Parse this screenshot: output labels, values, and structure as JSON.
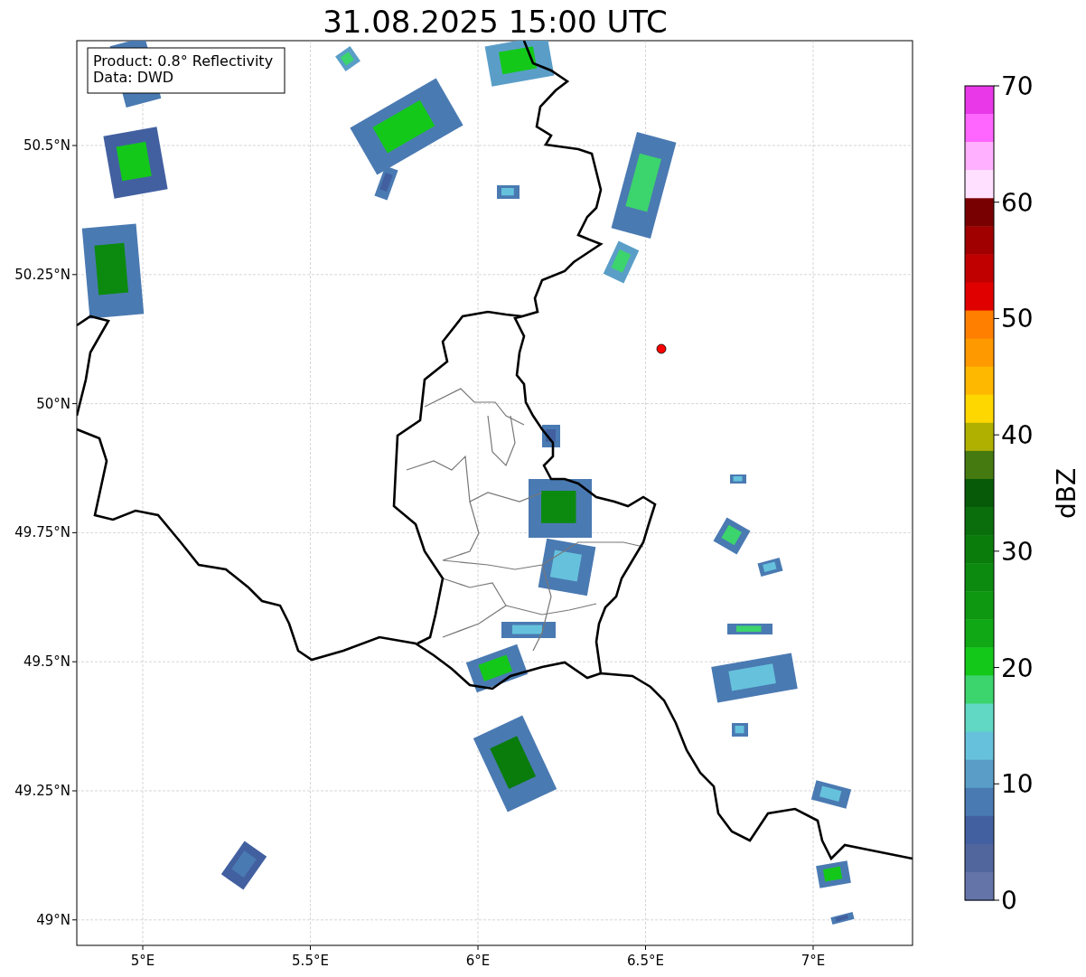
{
  "title": "31.08.2025 15:00 UTC",
  "info_box": {
    "lines": [
      "Product: 0.8° Reflectivity",
      "Data: DWD"
    ]
  },
  "map": {
    "y_labels": [
      "50.5°N",
      "50.25°N",
      "50°N",
      "49.75°N",
      "49.5°N",
      "49.25°N",
      "49°N"
    ],
    "x_labels": [
      "5°E",
      "5.5°E",
      "6°E",
      "6.5°E",
      "7°E"
    ]
  },
  "colorbar": {
    "label": "dBZ",
    "ticks": [
      "70",
      "60",
      "50",
      "40",
      "30",
      "20",
      "10",
      "0"
    ],
    "segments": [
      {
        "color": "#e838e8"
      },
      {
        "color": "#ff66ff"
      },
      {
        "color": "#ffb0ff"
      },
      {
        "color": "#ffe0ff"
      },
      {
        "color": "#780000"
      },
      {
        "color": "#a00000"
      },
      {
        "color": "#c00000"
      },
      {
        "color": "#e00000"
      },
      {
        "color": "#ff7f00"
      },
      {
        "color": "#ff9900"
      },
      {
        "color": "#ffb800"
      },
      {
        "color": "#ffd700"
      },
      {
        "color": "#b0b000"
      },
      {
        "color": "#457a10"
      },
      {
        "color": "#075a08"
      },
      {
        "color": "#0a6e0c"
      },
      {
        "color": "#0a7c0c"
      },
      {
        "color": "#0c8a10"
      },
      {
        "color": "#0e9812"
      },
      {
        "color": "#10a814"
      },
      {
        "color": "#14c81a"
      },
      {
        "color": "#3cd46c"
      },
      {
        "color": "#60d8c4"
      },
      {
        "color": "#66c2dc"
      },
      {
        "color": "#5a9ec8"
      },
      {
        "color": "#4a7ab2"
      },
      {
        "color": "#4260a0"
      },
      {
        "color": "#52669e"
      },
      {
        "color": "#6474a8"
      }
    ]
  }
}
